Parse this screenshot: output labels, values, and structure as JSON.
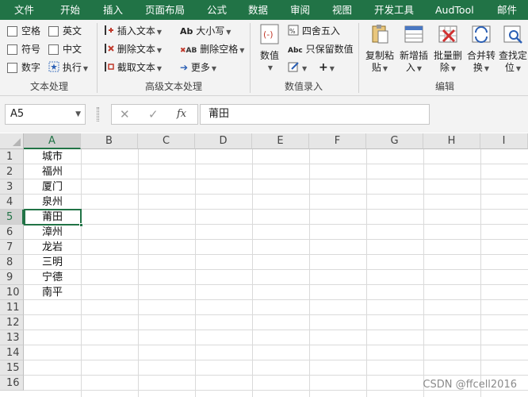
{
  "menu_tabs": [
    "文件",
    "开始",
    "插入",
    "页面布局",
    "公式",
    "数据",
    "审阅",
    "视图",
    "开发工具",
    "AudTool",
    "邮件"
  ],
  "ribbon": {
    "text_group": {
      "label": "文本处理",
      "options": [
        "空格",
        "英文",
        "符号",
        "中文",
        "数字",
        "执行"
      ]
    },
    "advanced_group": {
      "label": "高级文本处理",
      "insert_text": "插入文本",
      "delete_text": "删除文本",
      "extract_text": "截取文本",
      "case": "大小写",
      "delete_space": "删除空格",
      "more": "更多"
    },
    "number_group": {
      "label": "数值录入",
      "number": "数值",
      "round": "四舍五入",
      "keep_value": "只保留数值"
    },
    "edit_group": {
      "label": "编辑",
      "copy_paste": [
        "复制粘",
        "贴"
      ],
      "add_insert": [
        "新增插",
        "入"
      ],
      "batch_delete": [
        "批量删",
        "除"
      ],
      "merge_convert": [
        "合并转",
        "换"
      ],
      "find_locate": [
        "查找定",
        "位"
      ]
    },
    "colors": {
      "accent": "#217346",
      "ribbon_bg": "#f3f3f3"
    }
  },
  "formula_bar": {
    "name_box": "A5",
    "formula_value": "莆田",
    "fx_label": "fx"
  },
  "grid": {
    "columns": [
      "A",
      "B",
      "C",
      "D",
      "E",
      "F",
      "G",
      "H",
      "I"
    ],
    "rows": [
      "1",
      "2",
      "3",
      "4",
      "5",
      "6",
      "7",
      "8",
      "9",
      "10",
      "11",
      "12",
      "13",
      "14",
      "15",
      "16"
    ],
    "selected_column": "A",
    "selected_row": "5",
    "column_a_values": [
      "城市",
      "福州",
      "厦门",
      "泉州",
      "莆田",
      "漳州",
      "龙岩",
      "三明",
      "宁德",
      "南平"
    ]
  },
  "watermark": "CSDN @ffcell2016"
}
